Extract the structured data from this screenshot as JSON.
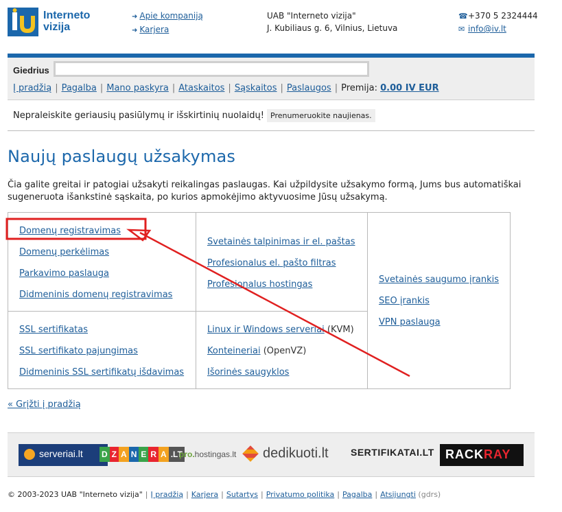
{
  "header": {
    "logo_line1": "Interneto",
    "logo_line2": "vizija",
    "links": [
      {
        "label": "Apie kompaniją"
      },
      {
        "label": "Karjera"
      }
    ],
    "company_name": "UAB \"Interneto vizija\"",
    "company_address": "J. Kubiliaus g. 6, Vilnius, Lietuva",
    "phone": "+370 5 2324444",
    "email": "info@iv.lt"
  },
  "user_panel": {
    "username": "Giedrius",
    "nav": [
      {
        "label": "Į pradžią"
      },
      {
        "label": "Pagalba"
      },
      {
        "label": "Mano paskyra"
      },
      {
        "label": "Ataskaitos"
      },
      {
        "label": "Sąskaitos"
      },
      {
        "label": "Paslaugos"
      }
    ],
    "bonus_label": "Premija:",
    "bonus_value": "0.00 IV EUR"
  },
  "promo": {
    "text": "Nepraleiskite geriausių pasiūlymų ir išskirtinių nuolaidų!",
    "subscribe_label": "Prenumeruokite naujienas."
  },
  "main": {
    "title": "Naujų paslaugų užsakymas",
    "intro": "Čia galite greitai ir patogiai užsakyti reikalingas paslaugas. Kai užpildysite užsakymo formą, Jums bus automatiškai sugeneruota išankstinė sąskaita, po kurios apmokėjimo aktyvuosime Jūsų užsakymą.",
    "domains": [
      "Domenų registravimas",
      "Domenų perkėlimas",
      "Parkavimo paslauga",
      "Didmeninis domenų registravimas"
    ],
    "hosting": [
      "Svetainės talpinimas ir el. paštas",
      "Profesionalus el. pašto filtras",
      "Profesionalus hostingas"
    ],
    "ssl": [
      "SSL sertifikatas",
      "SSL sertifikato pajungimas",
      "Didmeninis SSL sertifikatų išdavimas"
    ],
    "servers": [
      {
        "label": "Linux ir Windows serveriai",
        "note": "(KVM)"
      },
      {
        "label": "Konteineriai",
        "note": "(OpenVZ)"
      },
      {
        "label": "Išorinės saugyklos",
        "note": ""
      }
    ],
    "tools": [
      "Svetainės saugumo įrankis",
      "SEO įrankis",
      "VPN paslauga"
    ],
    "back_label": "« Grįžti į pradžią"
  },
  "partners": {
    "serveriai": "serveriai.lt",
    "dzanera_parts": [
      "D",
      "Z",
      "A",
      "N",
      "E",
      "R",
      "A",
      ".LT"
    ],
    "prohosting_a": "pro.",
    "prohosting_b": "hostingas.lt",
    "dedikuoti": "dedikuoti.lt",
    "sertifikatai": "SERTIFIKATAI.LT",
    "rack_a": "RACK",
    "rack_b": "RAY"
  },
  "footer": {
    "copyright": "© 2003-2023 UAB \"Interneto vizija\"",
    "links": [
      "Į pradžią",
      "Karjera",
      "Sutartys",
      "Privatumo politika",
      "Pagalba",
      "Atsijungti"
    ],
    "user_tag": "(gdrs)"
  },
  "colors": {
    "brand_blue": "#1b67ab",
    "link": "#1d5d99",
    "annotation_red": "#e02020"
  }
}
